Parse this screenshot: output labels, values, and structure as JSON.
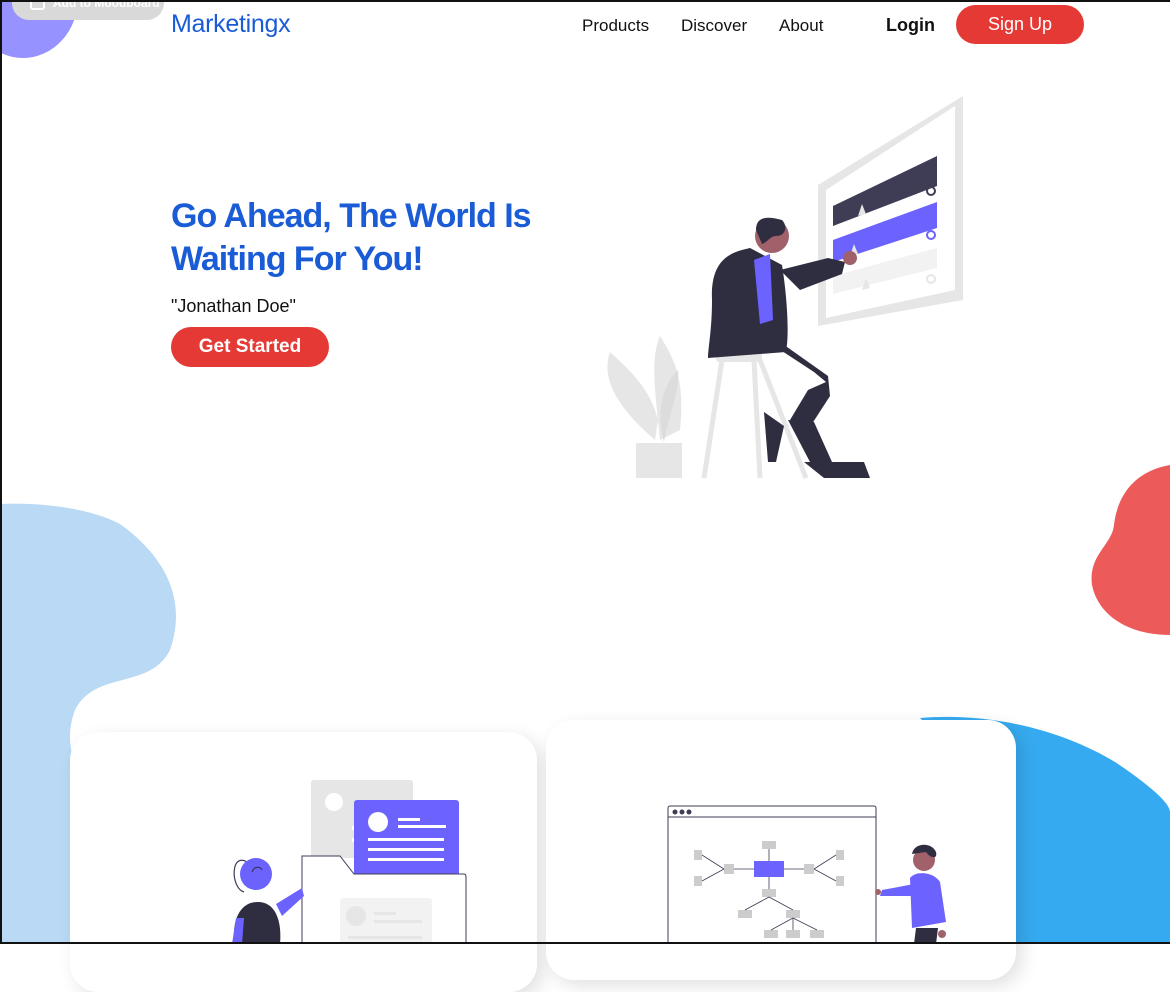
{
  "moodboard": {
    "label": "Add to Moodboard"
  },
  "header": {
    "logo": "Marketingx",
    "nav": {
      "products": "Products",
      "discover": "Discover",
      "about": "About"
    },
    "login": "Login",
    "signup": "Sign Up"
  },
  "hero": {
    "title": "Go Ahead, The World Is Waiting For You!",
    "quote": "\"Jonathan Doe\"",
    "cta": "Get Started"
  },
  "colors": {
    "brand_blue": "#1a5bd6",
    "accent_red": "#e53935",
    "purple": "#6c63ff",
    "light_blue_blob": "#b9d9f5",
    "bright_blue_blob": "#36aaf0",
    "red_blob": "#ec5b59"
  },
  "icons": [
    "shopping-bag-icon"
  ]
}
